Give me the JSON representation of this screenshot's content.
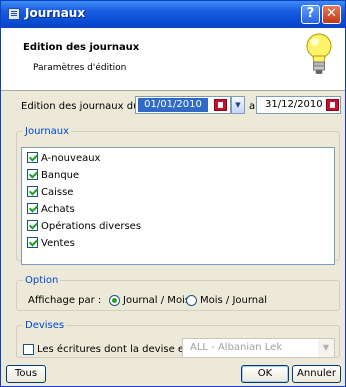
{
  "window": {
    "title": "Journaux",
    "help_label": "?",
    "close_label": "✕"
  },
  "header": {
    "title": "Edition des journaux",
    "subtitle": "Paramètres d'édition",
    "icon": "lightbulb-icon"
  },
  "dates": {
    "label": "Edition des journaux du :",
    "from": "01/01/2010",
    "separator": "au",
    "to": "31/12/2010"
  },
  "journaux": {
    "legend": "Journaux",
    "items": [
      {
        "label": "A-nouveaux",
        "checked": true
      },
      {
        "label": "Banque",
        "checked": true
      },
      {
        "label": "Caisse",
        "checked": true
      },
      {
        "label": "Achats",
        "checked": true
      },
      {
        "label": "Opérations diverses",
        "checked": true
      },
      {
        "label": "Ventes",
        "checked": true
      }
    ]
  },
  "option": {
    "legend": "Option",
    "label": "Affichage par :",
    "choice1": "Journal / Mois",
    "choice2": "Mois / Journal",
    "selected": "Journal / Mois"
  },
  "devises": {
    "legend": "Devises",
    "checkbox_label": "Les écritures dont la devise est :",
    "checked": false,
    "currency_value": "ALL - Albanian Lek"
  },
  "buttons": {
    "tous": "Tous",
    "ok": "OK",
    "annuler": "Annuler"
  },
  "colors": {
    "titlebar": "#0a4fd8",
    "selection": "#316ac5",
    "group_legend": "#0046d5",
    "check": "#21a121"
  }
}
